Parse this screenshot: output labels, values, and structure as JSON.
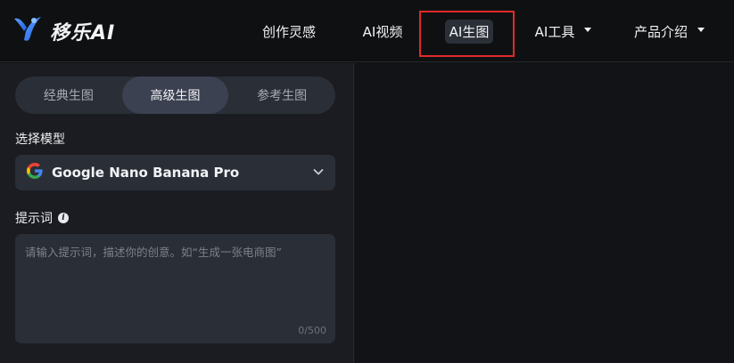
{
  "brand": {
    "name": "移乐AI"
  },
  "nav": {
    "items": [
      {
        "label": "创作灵感"
      },
      {
        "label": "AI视频"
      },
      {
        "label": "AI生图"
      },
      {
        "label": "AI工具"
      },
      {
        "label": "产品介绍"
      }
    ],
    "active_index": 2
  },
  "tabs": [
    {
      "label": "经典生图"
    },
    {
      "label": "高级生图"
    },
    {
      "label": "参考生图"
    }
  ],
  "model": {
    "section_label": "选择模型",
    "selected": "Google Nano Banana Pro"
  },
  "prompt": {
    "section_label": "提示词",
    "placeholder": "请输入提示词，描述你的创意。如“生成一张电商图”",
    "counter": "0/500"
  },
  "colors": {
    "brand_blue": "#3b82f6",
    "highlight": "#e02a2a"
  }
}
